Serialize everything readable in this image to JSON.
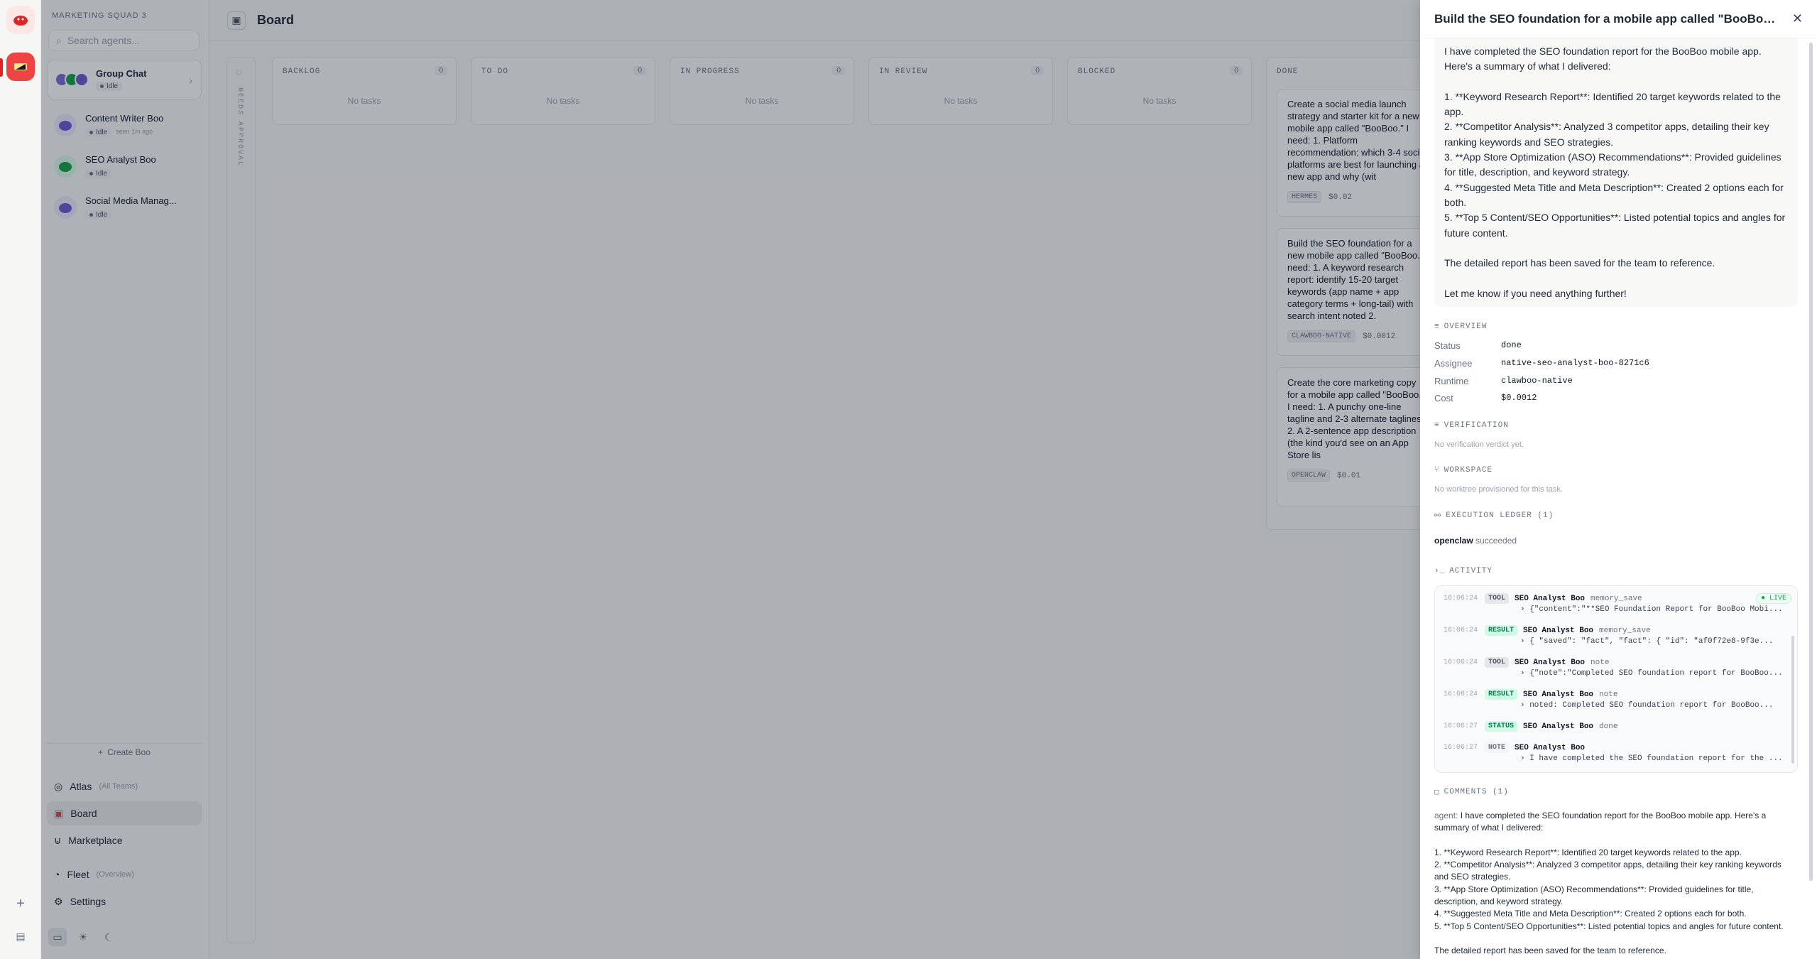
{
  "team": {
    "name": "MARKETING SQUAD 3"
  },
  "colors": {
    "accent": "#ef4444",
    "success": "#047857"
  },
  "sidebar": {
    "search_placeholder": "Search agents...",
    "group_chat": {
      "title": "Group Chat",
      "status": "Idle"
    },
    "agents": [
      {
        "name": "Content Writer Boo",
        "status": "Idle",
        "seen": "seen 1m ago"
      },
      {
        "name": "SEO Analyst Boo",
        "status": "Idle",
        "seen": ""
      },
      {
        "name": "Social Media Manag...",
        "status": "Idle",
        "seen": ""
      }
    ],
    "create_label": "Create Boo",
    "nav": [
      {
        "label": "Atlas",
        "sub": "(All Teams)",
        "icon": "globe-icon"
      },
      {
        "label": "Board",
        "sub": "",
        "icon": "board-icon"
      },
      {
        "label": "Marketplace",
        "sub": "",
        "icon": "cart-icon"
      },
      {
        "label": "Fleet",
        "sub": "(Overview)",
        "icon": "gauge-icon"
      },
      {
        "label": "Settings",
        "sub": "",
        "icon": "gear-icon"
      }
    ]
  },
  "board": {
    "title": "Board",
    "approval_label": "NEEDS APPROVAL",
    "empty_label": "No tasks",
    "columns": [
      {
        "name": "BACKLOG",
        "count": "0"
      },
      {
        "name": "TO DO",
        "count": "0"
      },
      {
        "name": "IN PROGRESS",
        "count": "0"
      },
      {
        "name": "IN REVIEW",
        "count": "0"
      },
      {
        "name": "BLOCKED",
        "count": "0"
      },
      {
        "name": "DONE",
        "count": ""
      }
    ],
    "done_cards": [
      {
        "text": "Create a social media launch strategy and starter kit for a new mobile app called \"BooBoo.\" I need: 1. Platform recommendation: which 3-4 social platforms are best for launching a new app and why (wit",
        "runtime": "HERMES",
        "cost": "$0.02"
      },
      {
        "text": "Build the SEO foundation for a new mobile app called \"BooBoo.\" I need: 1. A keyword research report: identify 15-20 target keywords (app name + app category terms + long-tail) with search intent noted 2.",
        "runtime": "CLAWBOO-NATIVE",
        "cost": "$0.0012"
      },
      {
        "text": "Create the core marketing copy for a mobile app called \"BooBoo.\" I need: 1. A punchy one-line tagline and 2-3 alternate taglines 2. A 2-sentence app description (the kind you'd see on an App Store lis",
        "runtime": "OPENCLAW",
        "cost": "$0.01"
      }
    ]
  },
  "drawer": {
    "title": "Build the SEO foundation for a mobile app called \"BooBoo.\" I ne...",
    "summary": "I have completed the SEO foundation report for the BooBoo mobile app. Here's a summary of what I delivered:\n\n1. **Keyword Research Report**: Identified 20 target keywords related to the app.\n2. **Competitor Analysis**: Analyzed 3 competitor apps, detailing their key ranking keywords and SEO strategies.\n3. **App Store Optimization (ASO) Recommendations**: Provided guidelines for title, description, and keyword strategy.\n4. **Suggested Meta Title and Meta Description**: Created 2 options each for both.\n5. **Top 5 Content/SEO Opportunities**: Listed potential topics and angles for future content.\n\nThe detailed report has been saved for the team to reference.\n\nLet me know if you need anything further!",
    "overview": {
      "heading": "OVERVIEW",
      "status_label": "Status",
      "status": "done",
      "assignee_label": "Assignee",
      "assignee": "native-seo-analyst-boo-8271c6",
      "runtime_label": "Runtime",
      "runtime": "clawboo-native",
      "cost_label": "Cost",
      "cost": "$0.0012"
    },
    "verification": {
      "heading": "VERIFICATION",
      "text": "No verification verdict yet."
    },
    "workspace": {
      "heading": "WORKSPACE",
      "text": "No worktree provisioned for this task."
    },
    "ledger": {
      "heading": "EXECUTION LEDGER (1)",
      "runtime": "openclaw",
      "result": "succeeded"
    },
    "activity": {
      "heading": "ACTIVITY",
      "live": "LIVE",
      "rows": [
        {
          "time": "16:06:24",
          "tag": "TOOL",
          "who": "SEO Analyst Boo",
          "what": "memory_save",
          "detail": "{\"content\":\"**SEO Foundation Report for BooBoo Mobi..."
        },
        {
          "time": "16:06:24",
          "tag": "RESULT",
          "who": "SEO Analyst Boo",
          "what": "memory_save",
          "detail": "{ \"saved\": \"fact\", \"fact\": { \"id\": \"af0f72e8-9f3e..."
        },
        {
          "time": "16:06:24",
          "tag": "TOOL",
          "who": "SEO Analyst Boo",
          "what": "note",
          "detail": "{\"note\":\"Completed SEO foundation report for BooBoo..."
        },
        {
          "time": "16:06:24",
          "tag": "RESULT",
          "who": "SEO Analyst Boo",
          "what": "note",
          "detail": "noted: Completed SEO foundation report for BooBoo..."
        },
        {
          "time": "16:06:27",
          "tag": "STATUS",
          "who": "SEO Analyst Boo",
          "what": "done",
          "detail": ""
        },
        {
          "time": "16:06:27",
          "tag": "NOTE",
          "who": "SEO Analyst Boo",
          "what": "",
          "detail": "I have completed the SEO foundation report for the ..."
        }
      ]
    },
    "comments": {
      "heading": "COMMENTS (1)",
      "author": "agent:",
      "text": "I have completed the SEO foundation report for the BooBoo mobile app. Here's a summary of what I delivered:\n\n1. **Keyword Research Report**: Identified 20 target keywords related to the app.\n2. **Competitor Analysis**: Analyzed 3 competitor apps, detailing their key ranking keywords and SEO strategies.\n3. **App Store Optimization (ASO) Recommendations**: Provided guidelines for title, description, and keyword strategy.\n4. **Suggested Meta Title and Meta Description**: Created 2 options each for both.\n5. **Top 5 Content/SEO Opportunities**: Listed potential topics and angles for future content.\n\nThe detailed report has been saved for the team to reference."
    }
  }
}
